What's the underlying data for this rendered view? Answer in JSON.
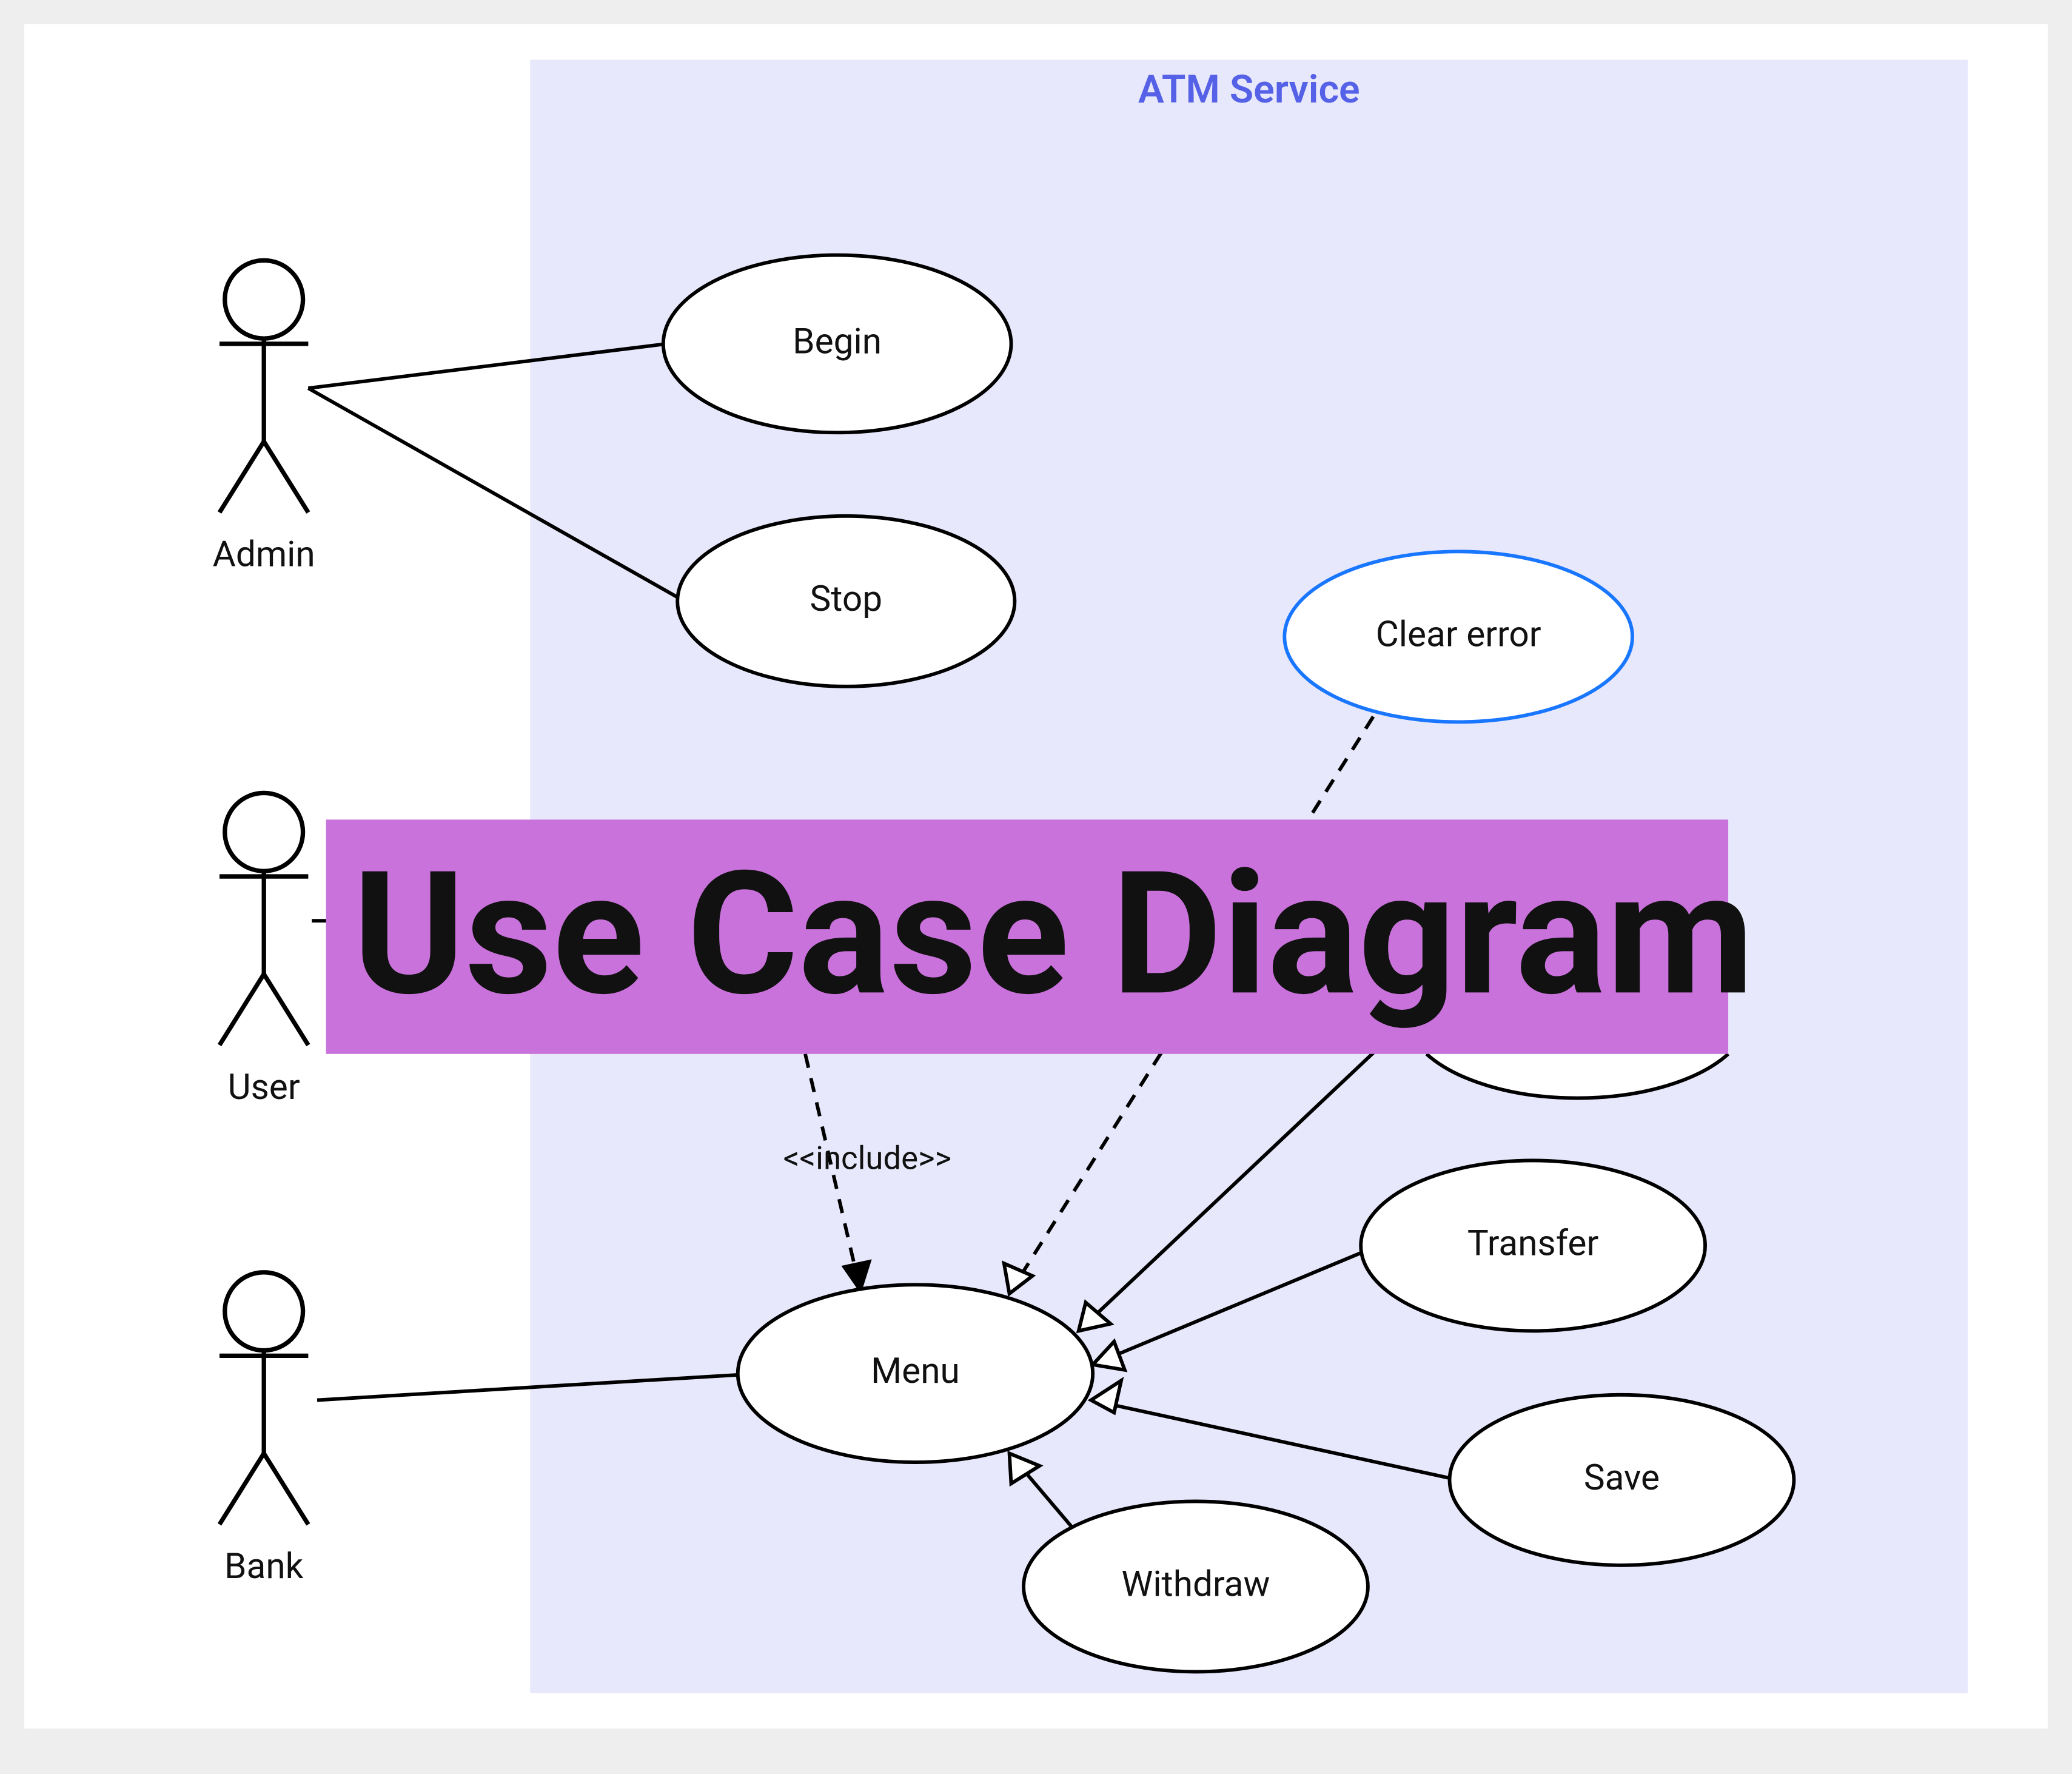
{
  "system": {
    "title": "ATM Service"
  },
  "banner": {
    "text": "Use Case Diagram"
  },
  "actors": {
    "admin": {
      "label": "Admin"
    },
    "user": {
      "label": "User"
    },
    "bank": {
      "label": "Bank"
    }
  },
  "usecases": {
    "begin": {
      "label": "Begin"
    },
    "stop": {
      "label": "Stop"
    },
    "clear": {
      "label": "Clear error"
    },
    "menu": {
      "label": "Menu"
    },
    "transfer": {
      "label": "Transfer"
    },
    "withdraw": {
      "label": "Withdraw"
    },
    "save": {
      "label": "Save"
    }
  },
  "relations": {
    "include": {
      "label": "<<include>>"
    }
  }
}
